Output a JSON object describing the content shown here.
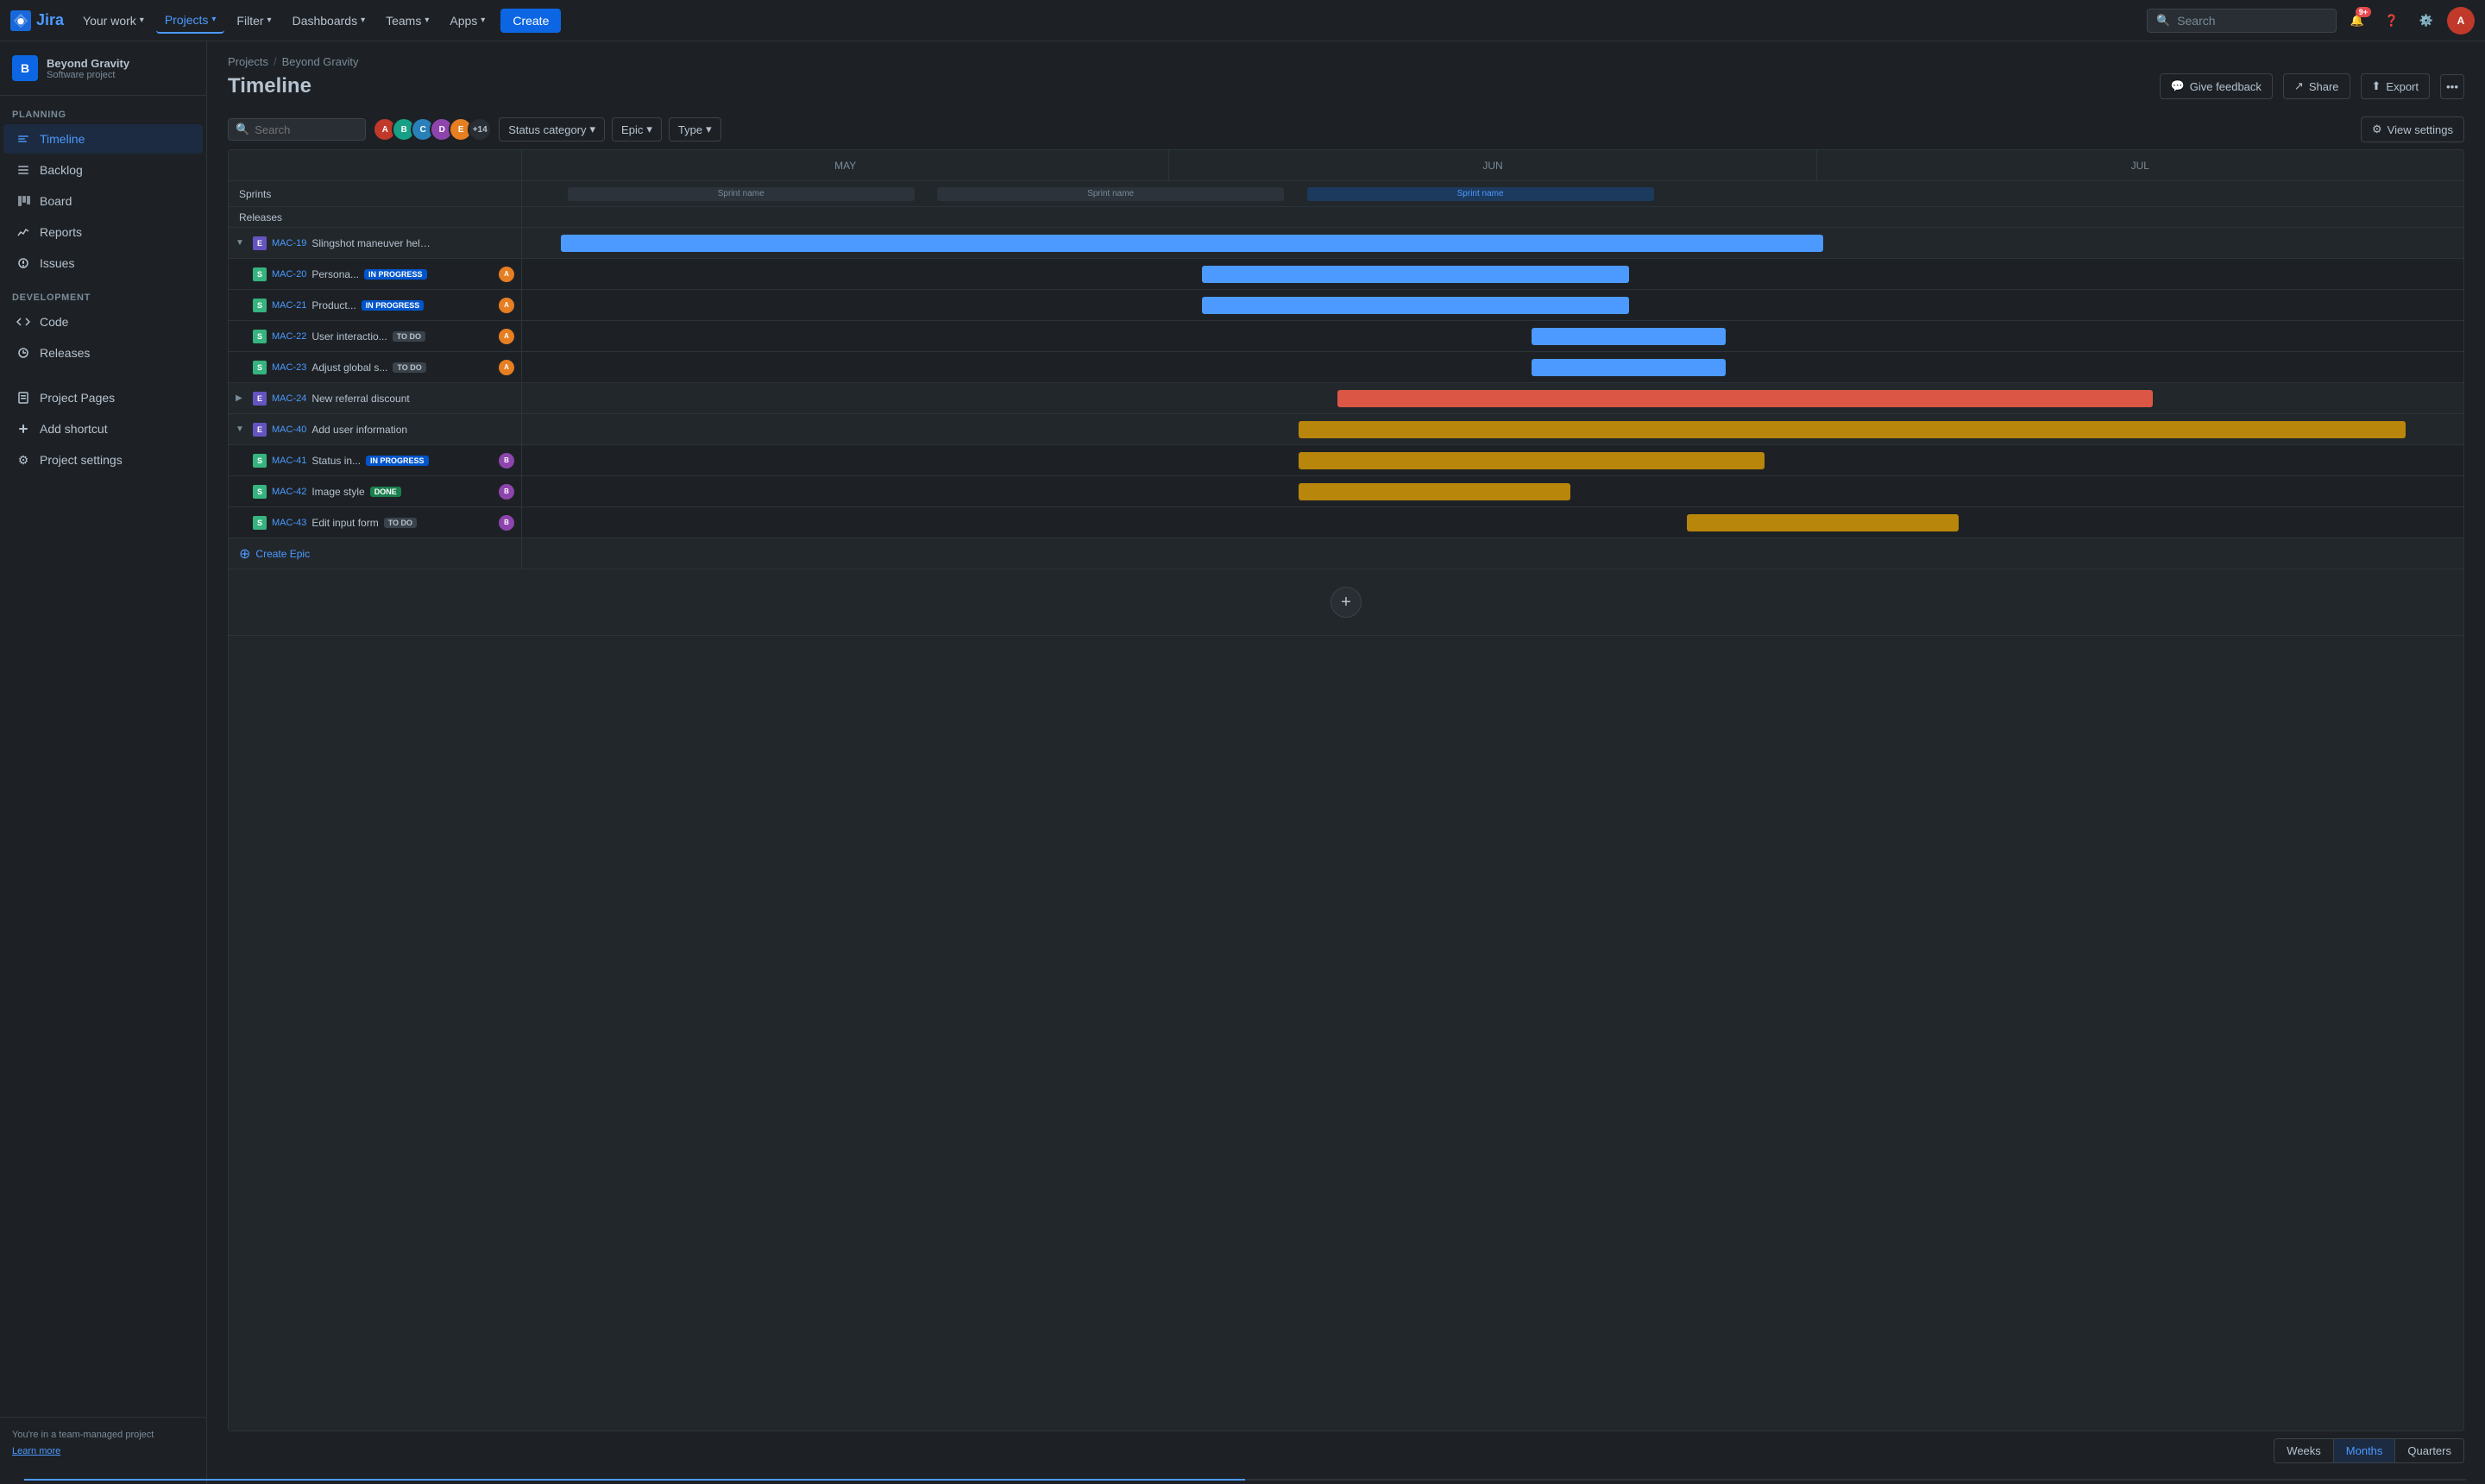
{
  "topNav": {
    "logoText": "Jira",
    "navItems": [
      {
        "label": "Your work",
        "hasChevron": true
      },
      {
        "label": "Projects",
        "hasChevron": true,
        "active": true
      },
      {
        "label": "Filter",
        "hasChevron": true
      },
      {
        "label": "Dashboards",
        "hasChevron": true
      },
      {
        "label": "Teams",
        "hasChevron": true
      },
      {
        "label": "Apps",
        "hasChevron": true
      }
    ],
    "createBtn": "Create",
    "search": {
      "placeholder": "Search"
    },
    "notifCount": "9+",
    "avatarInitials": "A"
  },
  "sidebar": {
    "project": {
      "name": "Beyond Gravity",
      "type": "Software project",
      "iconText": "B"
    },
    "planning": {
      "label": "PLANNING",
      "items": [
        {
          "label": "Timeline",
          "active": true
        },
        {
          "label": "Backlog"
        },
        {
          "label": "Board"
        },
        {
          "label": "Reports"
        },
        {
          "label": "Issues"
        }
      ]
    },
    "development": {
      "label": "DEVELOPMENT",
      "items": [
        {
          "label": "Code"
        },
        {
          "label": "Releases"
        }
      ]
    },
    "bottom": [
      {
        "label": "Project Pages"
      },
      {
        "label": "Add shortcut"
      },
      {
        "label": "Project settings"
      }
    ],
    "teamInfo": "You're in a team-managed project",
    "learnMore": "Learn more"
  },
  "page": {
    "breadcrumb": [
      "Projects",
      "Beyond Gravity"
    ],
    "title": "Timeline",
    "actions": {
      "feedback": "Give feedback",
      "share": "Share",
      "export": "Export",
      "more": "..."
    }
  },
  "filters": {
    "searchPlaceholder": "Search",
    "avatarCount": "+14",
    "statusCategory": "Status category",
    "epic": "Epic",
    "type": "Type",
    "viewSettings": "View settings"
  },
  "timeline": {
    "months": [
      "MAY",
      "JUN",
      "JUL"
    ],
    "sprints": {
      "label": "Sprints",
      "items": [
        {
          "label": "Sprint name",
          "active": false,
          "widthPct": 20
        },
        {
          "label": "Sprint name",
          "active": false,
          "widthPct": 20
        },
        {
          "label": "Sprint name",
          "active": true,
          "widthPct": 20
        }
      ]
    },
    "releases": {
      "label": "Releases"
    },
    "epics": [
      {
        "id": "MAC-19",
        "name": "Slingshot maneuver helper...",
        "type": "epic",
        "expanded": true,
        "barColor": "bar-blue",
        "barLeft": 2,
        "barWidth": 65,
        "children": [
          {
            "id": "MAC-20",
            "name": "Persona...",
            "type": "story",
            "status": "IN PROGRESS",
            "barColor": "bar-blue",
            "barLeft": 35,
            "barWidth": 22,
            "assigneeColor": "#e67e22",
            "progressColor": "#4c9aff",
            "progressPct": 40
          },
          {
            "id": "MAC-21",
            "name": "Product...",
            "type": "story",
            "status": "IN PROGRESS",
            "barColor": "bar-blue",
            "barLeft": 35,
            "barWidth": 22,
            "assigneeColor": "#e67e22",
            "progressColor": "#4c9aff",
            "progressPct": 30
          },
          {
            "id": "MAC-22",
            "name": "User interactio...",
            "type": "story",
            "status": "TO DO",
            "barColor": "bar-blue",
            "barLeft": 52,
            "barWidth": 10,
            "assigneeColor": "#e67e22",
            "progressColor": "#2c333a",
            "progressPct": 0
          },
          {
            "id": "MAC-23",
            "name": "Adjust global s...",
            "type": "story",
            "status": "TO DO",
            "barColor": "bar-blue",
            "barLeft": 52,
            "barWidth": 10,
            "assigneeColor": "#e67e22",
            "progressColor": "#2c333a",
            "progressPct": 0
          }
        ]
      },
      {
        "id": "MAC-24",
        "name": "New referral discount",
        "type": "epic",
        "expanded": false,
        "barColor": "bar-red",
        "barLeft": 42,
        "barWidth": 42,
        "children": []
      },
      {
        "id": "MAC-40",
        "name": "Add user information",
        "type": "epic",
        "expanded": true,
        "barColor": "bar-yellow",
        "barLeft": 40,
        "barWidth": 58,
        "children": [
          {
            "id": "MAC-41",
            "name": "Status in...",
            "type": "story",
            "status": "IN PROGRESS",
            "barColor": "bar-yellow",
            "barLeft": 40,
            "barWidth": 24,
            "assigneeColor": "#8e44ad",
            "progressColor": "#f0b429",
            "progressPct": 60
          },
          {
            "id": "MAC-42",
            "name": "Image style",
            "type": "story",
            "status": "DONE",
            "barColor": "bar-yellow",
            "barLeft": 40,
            "barWidth": 14,
            "assigneeColor": "#8e44ad",
            "progressColor": "#36b37e",
            "progressPct": 100
          },
          {
            "id": "MAC-43",
            "name": "Edit input form",
            "type": "story",
            "status": "TO DO",
            "barColor": "bar-yellow",
            "barLeft": 60,
            "barWidth": 14,
            "assigneeColor": "#8e44ad",
            "progressColor": "#2c333a",
            "progressPct": 0
          }
        ]
      }
    ],
    "createEpic": "Create Epic",
    "timeScale": {
      "weeks": "Weeks",
      "months": "Months",
      "quarters": "Quarters",
      "active": "Months"
    }
  }
}
